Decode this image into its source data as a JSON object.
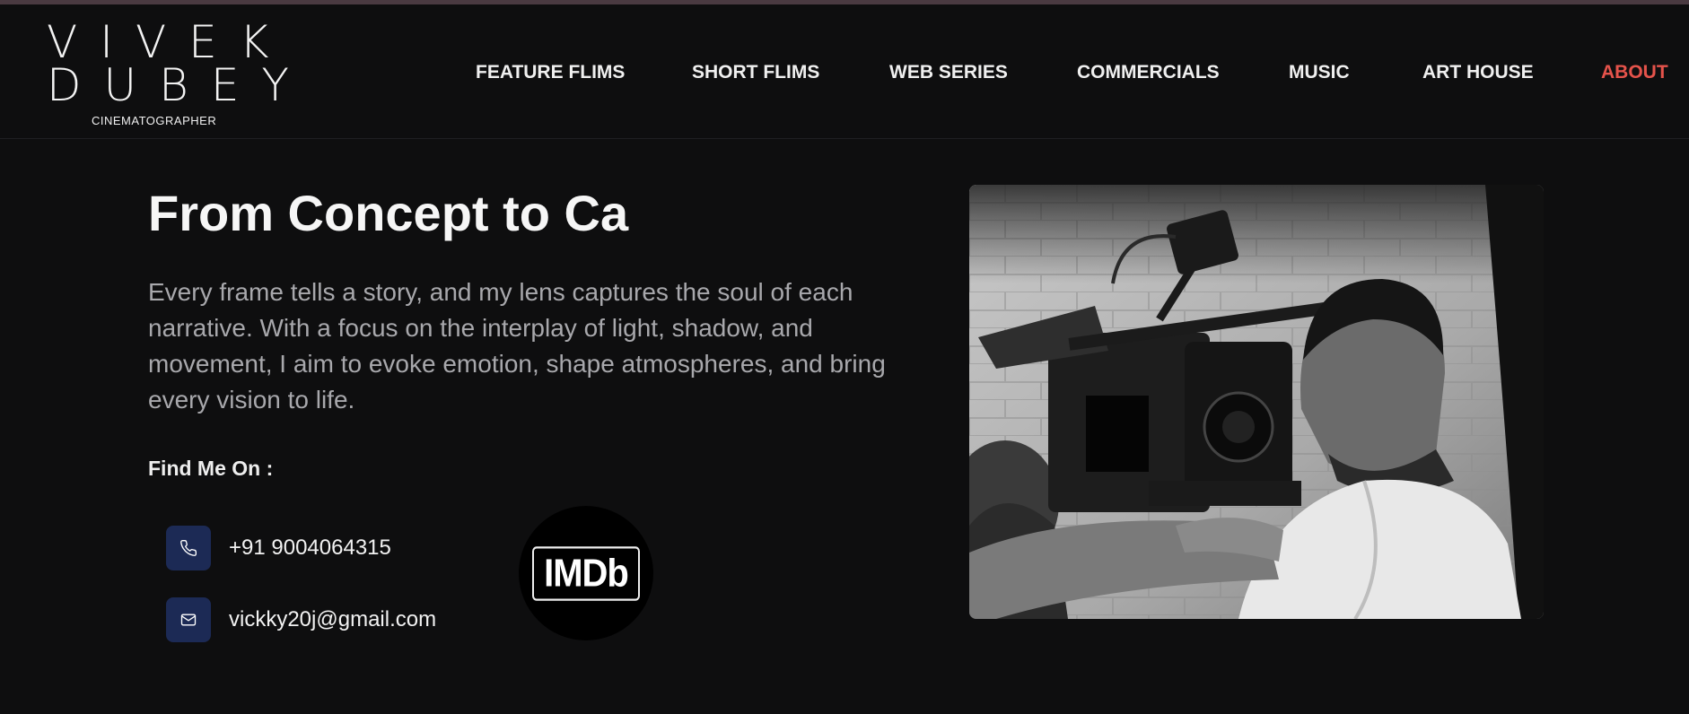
{
  "brand": {
    "name_line1": "VIVEK",
    "name_line2": "DUBEY",
    "tagline": "CINEMATOGRAPHER"
  },
  "nav": {
    "items": [
      {
        "label": "FEATURE FLIMS"
      },
      {
        "label": "SHORT FLIMS"
      },
      {
        "label": "WEB SERIES"
      },
      {
        "label": "COMMERCIALS"
      },
      {
        "label": "MUSIC"
      },
      {
        "label": "ART HOUSE"
      },
      {
        "label": "ABOUT",
        "active": true
      }
    ]
  },
  "hero": {
    "headline": "From Concept to Ca",
    "intro": "Every frame tells a story, and my lens captures the soul of each narrative. With a focus on the interplay of light, shadow, and movement, I aim to evoke emotion, shape atmospheres, and bring every vision to life."
  },
  "contact": {
    "find_label": "Find Me On :",
    "phone": "+91 9004064315",
    "email": "vickky20j@gmail.com",
    "phone_icon": "phone-icon",
    "email_icon": "mail-icon"
  },
  "social": {
    "imdb_label": "IMDb"
  },
  "colors": {
    "background": "#0e0e0f",
    "accent": "#e5534b",
    "icon_bg": "#1c2a55",
    "text_muted": "#a8a8ac"
  }
}
